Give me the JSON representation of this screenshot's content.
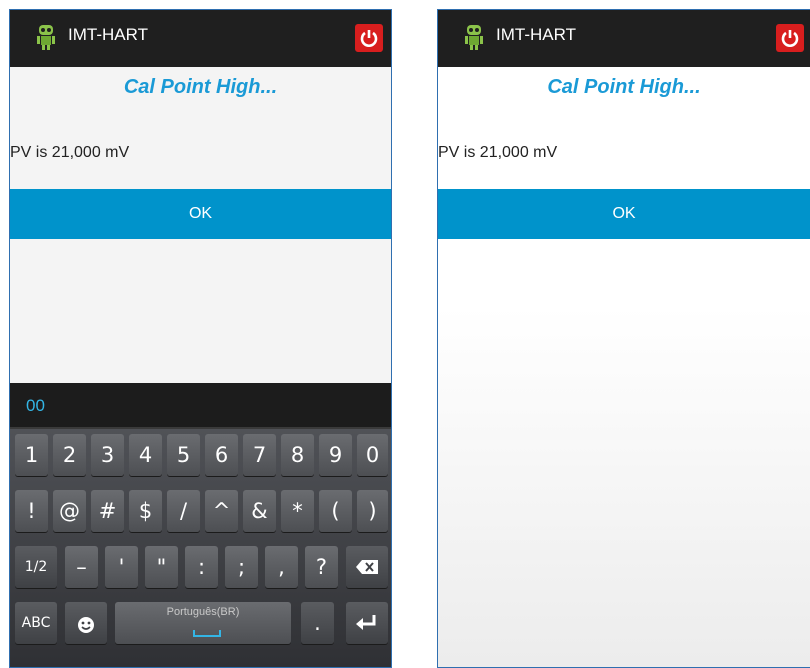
{
  "app": {
    "title": "IMT-HART"
  },
  "dialog": {
    "title": "Cal Point High...",
    "message": "PV is 21,000 mV",
    "ok_label": "OK"
  },
  "keyboard": {
    "input_preview": "00",
    "row1": [
      "1",
      "2",
      "3",
      "4",
      "5",
      "6",
      "7",
      "8",
      "9",
      "0"
    ],
    "row2": [
      "!",
      "@",
      "#",
      "$",
      "/",
      "^",
      "&",
      "*",
      "(",
      ")"
    ],
    "row3": {
      "shift": "1/2",
      "keys": [
        "–",
        "'",
        "\"",
        ":",
        ";",
        ",",
        "?"
      ]
    },
    "row4": {
      "abc": "ABC",
      "space_label": "Português(BR)",
      "period": "."
    }
  },
  "colors": {
    "accent": "#0093cb",
    "title_blue": "#1a9ad6",
    "power_red": "#d81e1e",
    "titlebar": "#1f1f1f"
  },
  "icons": [
    "android-icon",
    "power-icon",
    "backspace-icon",
    "enter-icon",
    "emoji-icon"
  ]
}
